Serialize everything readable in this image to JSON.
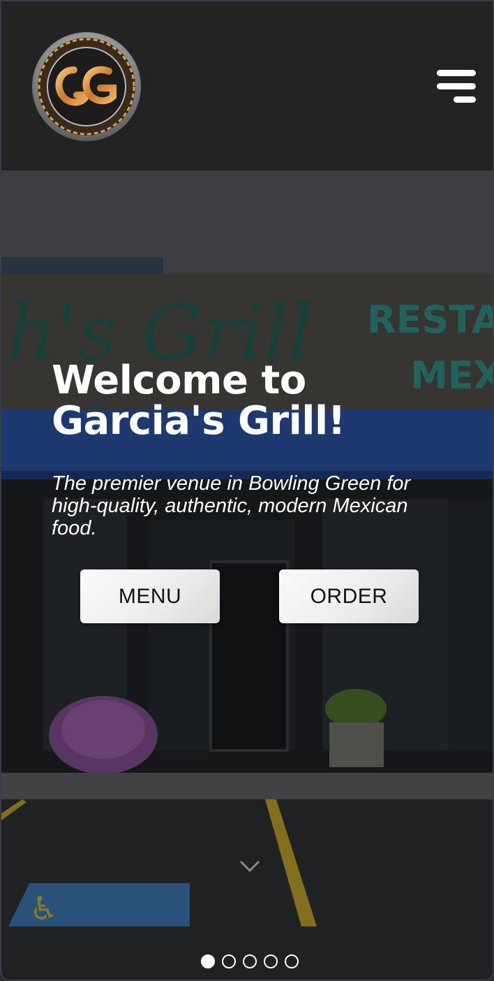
{
  "header": {
    "logo_icon": "garcias-grill-logo-icon",
    "menu_icon": "hamburger-menu-icon"
  },
  "hero": {
    "title": "Welcome to Garcia's Grill!",
    "subtitle": "The premier venue in Bowling Green for high-quality, authentic, modern Mexican food.",
    "menu_button": "MENU",
    "order_button": "ORDER",
    "scroll_icon": "chevron-down-icon",
    "slides_total": 5,
    "active_slide": 1
  },
  "colors": {
    "header_bg": "#232323",
    "logo_gold": "#d9913f",
    "sign_teal": "#2f8a80",
    "awning_blue": "#2f5fbf"
  }
}
